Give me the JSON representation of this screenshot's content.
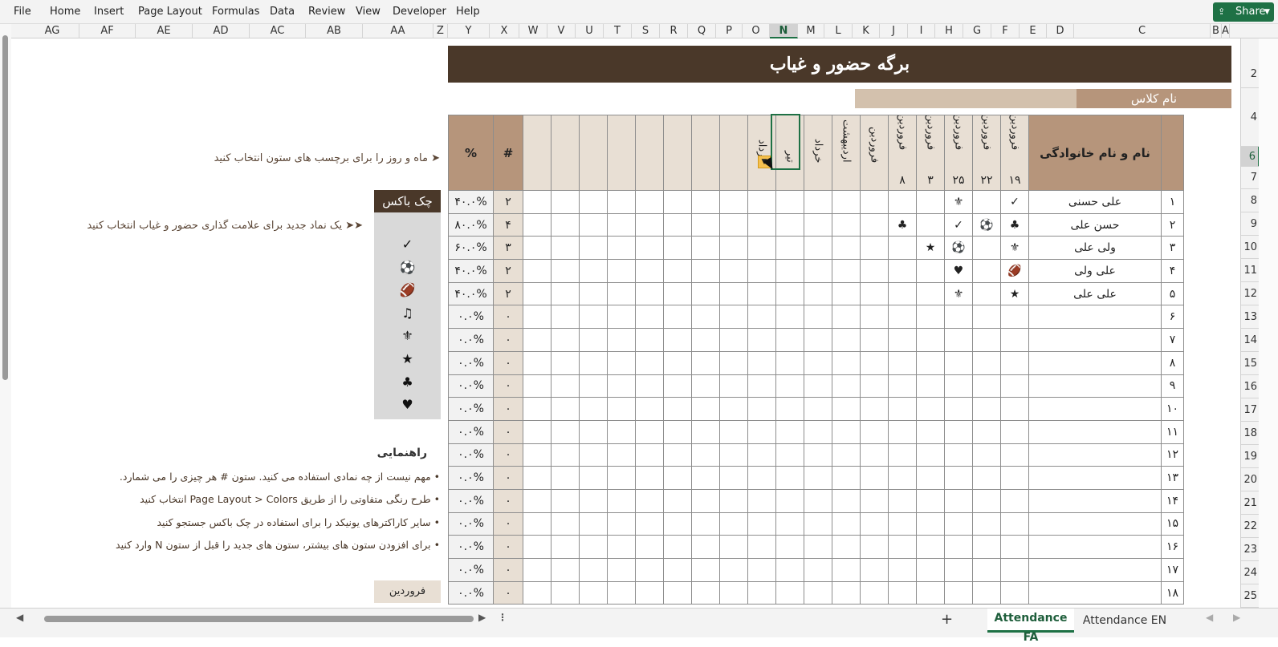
{
  "menu": [
    "File",
    "Home",
    "Insert",
    "Page Layout",
    "Formulas",
    "Data",
    "Review",
    "View",
    "Developer",
    "Help"
  ],
  "share_label": "Share",
  "columns": [
    "AG",
    "AF",
    "AE",
    "AD",
    "AC",
    "AB",
    "AA",
    "Z",
    "Y",
    "X",
    "W",
    "V",
    "U",
    "T",
    "S",
    "R",
    "Q",
    "P",
    "O",
    "N",
    "M",
    "L",
    "K",
    "J",
    "I",
    "H",
    "G",
    "F",
    "E",
    "D",
    "C",
    "B",
    "A"
  ],
  "rows": [
    "2",
    "4",
    "6",
    "7",
    "8",
    "9",
    "10",
    "11",
    "12",
    "13",
    "14",
    "15",
    "16",
    "17",
    "18",
    "19",
    "20",
    "21",
    "22",
    "23",
    "24",
    "25"
  ],
  "title": "برگه حضور و غیاب",
  "class_label": "نام کلاس",
  "headers": {
    "pct": "%",
    "count": "#",
    "name": "نام و نام خانوادگی",
    "months": [
      "مرداد",
      "تیر",
      "خرداد",
      "اردیبهشت",
      "فروردین",
      "فروردین",
      "فروردین",
      "فروردین",
      "فروردین",
      "فروردین"
    ],
    "days": [
      "",
      "",
      "",
      "",
      "",
      "۸",
      "۳",
      "۲۵",
      "۲۲",
      "۱۹"
    ]
  },
  "students": [
    {
      "num": "۱",
      "name": "علی حسنی",
      "count": "۲",
      "pct": "۴۰.۰%",
      "marks": [
        "",
        "",
        "",
        "",
        "",
        "",
        "",
        "⚜",
        "",
        "✓"
      ]
    },
    {
      "num": "۲",
      "name": "حسن علی",
      "count": "۴",
      "pct": "۸۰.۰%",
      "marks": [
        "",
        "",
        "",
        "",
        "",
        "♣",
        "",
        "✓",
        "⚽",
        "♣"
      ]
    },
    {
      "num": "۳",
      "name": "ولی علی",
      "count": "۳",
      "pct": "۶۰.۰%",
      "marks": [
        "",
        "",
        "",
        "",
        "",
        "",
        "★",
        "⚽",
        "",
        "⚜"
      ]
    },
    {
      "num": "۴",
      "name": "علی ولی",
      "count": "۲",
      "pct": "۴۰.۰%",
      "marks": [
        "",
        "",
        "",
        "",
        "",
        "",
        "",
        "♥",
        "",
        "🏈"
      ]
    },
    {
      "num": "۵",
      "name": "علی علی",
      "count": "۲",
      "pct": "۴۰.۰%",
      "marks": [
        "",
        "",
        "",
        "",
        "",
        "",
        "",
        "⚜",
        "",
        "★"
      ]
    },
    {
      "num": "۶",
      "name": "",
      "count": "۰",
      "pct": "۰.۰%",
      "marks": [
        "",
        "",
        "",
        "",
        "",
        "",
        "",
        "",
        "",
        ""
      ]
    },
    {
      "num": "۷",
      "name": "",
      "count": "۰",
      "pct": "۰.۰%",
      "marks": [
        "",
        "",
        "",
        "",
        "",
        "",
        "",
        "",
        "",
        ""
      ]
    },
    {
      "num": "۸",
      "name": "",
      "count": "۰",
      "pct": "۰.۰%",
      "marks": [
        "",
        "",
        "",
        "",
        "",
        "",
        "",
        "",
        "",
        ""
      ]
    },
    {
      "num": "۹",
      "name": "",
      "count": "۰",
      "pct": "۰.۰%",
      "marks": [
        "",
        "",
        "",
        "",
        "",
        "",
        "",
        "",
        "",
        ""
      ]
    },
    {
      "num": "۱۰",
      "name": "",
      "count": "۰",
      "pct": "۰.۰%",
      "marks": [
        "",
        "",
        "",
        "",
        "",
        "",
        "",
        "",
        "",
        ""
      ]
    },
    {
      "num": "۱۱",
      "name": "",
      "count": "۰",
      "pct": "۰.۰%",
      "marks": [
        "",
        "",
        "",
        "",
        "",
        "",
        "",
        "",
        "",
        ""
      ]
    },
    {
      "num": "۱۲",
      "name": "",
      "count": "۰",
      "pct": "۰.۰%",
      "marks": [
        "",
        "",
        "",
        "",
        "",
        "",
        "",
        "",
        "",
        ""
      ]
    },
    {
      "num": "۱۳",
      "name": "",
      "count": "۰",
      "pct": "۰.۰%",
      "marks": [
        "",
        "",
        "",
        "",
        "",
        "",
        "",
        "",
        "",
        ""
      ]
    },
    {
      "num": "۱۴",
      "name": "",
      "count": "۰",
      "pct": "۰.۰%",
      "marks": [
        "",
        "",
        "",
        "",
        "",
        "",
        "",
        "",
        "",
        ""
      ]
    },
    {
      "num": "۱۵",
      "name": "",
      "count": "۰",
      "pct": "۰.۰%",
      "marks": [
        "",
        "",
        "",
        "",
        "",
        "",
        "",
        "",
        "",
        ""
      ]
    },
    {
      "num": "۱۶",
      "name": "",
      "count": "۰",
      "pct": "۰.۰%",
      "marks": [
        "",
        "",
        "",
        "",
        "",
        "",
        "",
        "",
        "",
        ""
      ]
    },
    {
      "num": "۱۷",
      "name": "",
      "count": "۰",
      "pct": "۰.۰%",
      "marks": [
        "",
        "",
        "",
        "",
        "",
        "",
        "",
        "",
        "",
        ""
      ]
    },
    {
      "num": "۱۸",
      "name": "",
      "count": "۰",
      "pct": "۰.۰%",
      "marks": [
        "",
        "",
        "",
        "",
        "",
        "",
        "",
        "",
        "",
        ""
      ]
    }
  ],
  "hint_month": "➤ ماه و روز را برای برچسب های ستون انتخاب کنید",
  "hint_symbol": "➤➤ یک نماد جدید برای علامت گذاری حضور و غیاب انتخاب کنید",
  "checkbox": {
    "title": "چک باکس",
    "symbols": [
      "✓",
      "⚽",
      "🏈",
      "♫",
      "⚜",
      "★",
      "♣",
      "♥"
    ]
  },
  "guide": {
    "title": "راهنمایی",
    "items": [
      "• مهم نیست از چه نمادی استفاده می کنید. ستون # هر چیزی را می شمارد.",
      "• طرح رنگی متفاوتی را از طریق Page Layout > Colors انتخاب کنید",
      "• سایر کاراکترهای یونیکد را برای استفاده در چک باکس جستجو کنید",
      "• برای افزودن ستون های بیشتر، ستون های جدید را قبل از ستون N وارد کنید"
    ]
  },
  "month_cell": "فروردین",
  "tabs": [
    "Attendance FA",
    "Attendance EN"
  ],
  "colors": {
    "title_bg": "#4a3829",
    "header_bg": "#b6957b",
    "light_bg": "#e8dfd4",
    "accent": "#1e7145"
  }
}
